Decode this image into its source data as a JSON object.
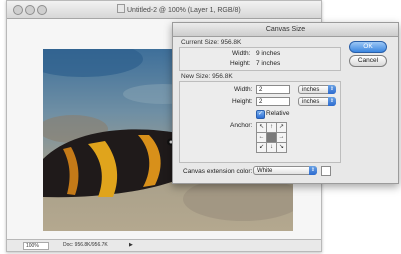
{
  "document": {
    "title": "Untitled-2 @ 100% (Layer 1, RGB/8)",
    "zoom": "100%",
    "status": "Doc: 956.8K/956.7K"
  },
  "dialog": {
    "title": "Canvas Size",
    "current_size": {
      "label": "Current Size: 956.8K",
      "width_label": "Width:",
      "width_value": "9 inches",
      "height_label": "Height:",
      "height_value": "7 inches"
    },
    "new_size": {
      "label": "New Size: 956.8K",
      "width_label": "Width:",
      "width_value": "2",
      "width_unit": "inches",
      "height_label": "Height:",
      "height_value": "2",
      "height_unit": "inches",
      "relative_label": "Relative",
      "relative_checked": true,
      "anchor_label": "Anchor:"
    },
    "extension_color_label": "Canvas extension color:",
    "extension_color_value": "White",
    "ok_label": "OK",
    "cancel_label": "Cancel"
  },
  "colors": {
    "accent": "#3b86e0",
    "dialog_bg": "#e8e8e8"
  }
}
